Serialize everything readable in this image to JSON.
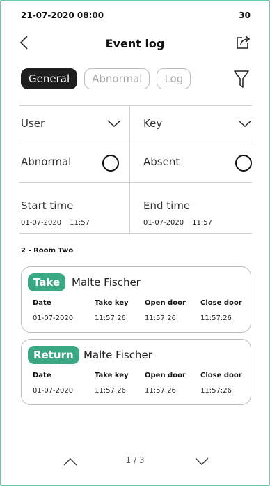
{
  "status": {
    "datetime": "21-07-2020 08:00",
    "value": "30"
  },
  "header": {
    "title": "Event log",
    "back_icon": "chevron-left-icon",
    "share_icon": "share-icon"
  },
  "tabs": [
    {
      "label": "General",
      "active": true
    },
    {
      "label": "Abnormal",
      "active": false
    },
    {
      "label": "Log",
      "active": false
    }
  ],
  "filter_icon": "filter-icon",
  "filters": {
    "user_label": "User",
    "key_label": "Key",
    "abnormal_label": "Abnormal",
    "absent_label": "Absent",
    "start_label": "Start time",
    "start_date": "01-07-2020",
    "start_time": "11:57",
    "end_label": "End time",
    "end_date": "01-07-2020",
    "end_time": "11:57"
  },
  "section_title": "2 - Room Two",
  "columns": {
    "date": "Date",
    "take_key": "Take key",
    "open_door": "Open door",
    "close_door": "Close door"
  },
  "events": [
    {
      "type": "Take",
      "name": "Malte Fischer",
      "date": "01-07-2020",
      "take_key": "11:57:26",
      "open_door": "11:57:26",
      "close_door": "11:57:26"
    },
    {
      "type": "Return",
      "name": "Malte Fischer",
      "date": "01-07-2020",
      "take_key": "11:57:26",
      "open_door": "11:57:26",
      "close_door": "11:57:26"
    }
  ],
  "pagination": {
    "label": "1 / 3"
  },
  "colors": {
    "accent": "#3aa882",
    "frame": "#6cc7a8",
    "active_tab": "#1e1e1e"
  }
}
